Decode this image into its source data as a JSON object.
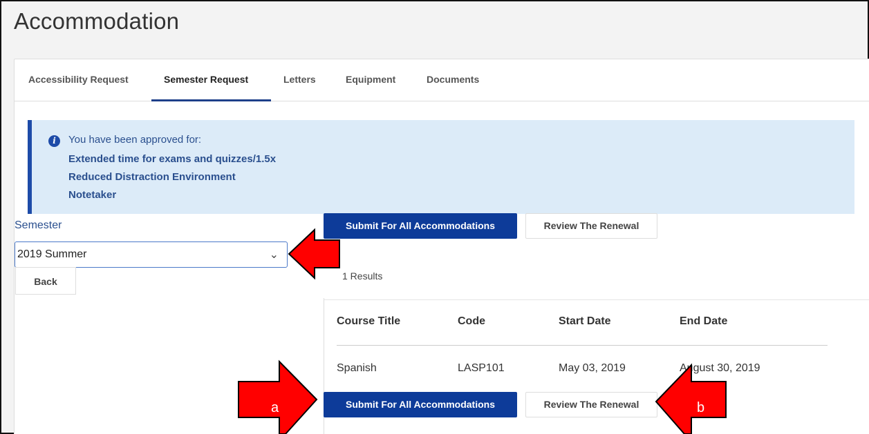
{
  "page": {
    "title": "Accommodation"
  },
  "tabs": [
    {
      "label": "Accessibility Request",
      "active": false
    },
    {
      "label": "Semester Request",
      "active": true
    },
    {
      "label": "Letters",
      "active": false
    },
    {
      "label": "Equipment",
      "active": false
    },
    {
      "label": "Documents",
      "active": false
    }
  ],
  "alert": {
    "icon": "info-icon",
    "intro": "You have been approved for:",
    "items": [
      "Extended time for exams and quizzes/1.5x",
      "Reduced Distraction Environment",
      "Notetaker"
    ]
  },
  "semester": {
    "label": "Semester",
    "selected": "2019 Summer",
    "back_label": "Back"
  },
  "actions": {
    "submit_label": "Submit For All Accommodations",
    "review_label": "Review The Renewal"
  },
  "results": {
    "count_text": "1 Results",
    "columns": [
      "Course Title",
      "Code",
      "Start Date",
      "End Date"
    ],
    "rows": [
      [
        "Spanish",
        "LASP101",
        "May 03, 2019",
        "August 30, 2019"
      ]
    ]
  },
  "annotations": {
    "left_arrow_label": "a",
    "right_arrow_label": "b"
  },
  "colors": {
    "primary": "#0d3b99",
    "tab_active": "#1d3f8a",
    "alert_bg": "#dcebf8",
    "alert_border": "#1d4ba8",
    "arrow_red": "#ff0000"
  }
}
